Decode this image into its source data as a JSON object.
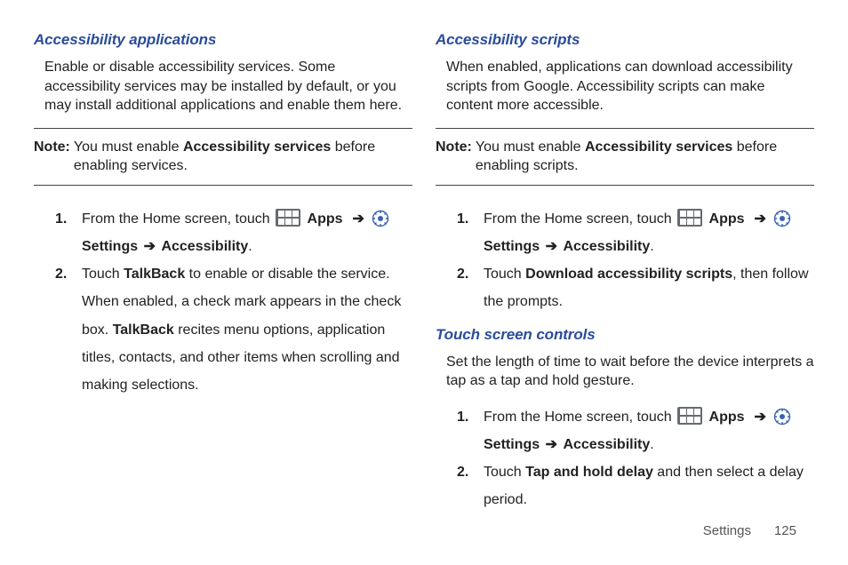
{
  "footer": {
    "section": "Settings",
    "page": "125"
  },
  "left": {
    "heading": "Accessibility applications",
    "intro": "Enable or disable accessibility services. Some accessibility services may be installed by default, or you may install additional applications and enable them here.",
    "note": {
      "label": "Note:",
      "pre": "You must enable ",
      "bold": "Accessibility services",
      "post": " before enabling services."
    },
    "steps": {
      "s1": {
        "pre": "From the Home screen, touch ",
        "apps": "Apps",
        "arrow1": "➔",
        "settings": "Settings",
        "arrow2": "➔",
        "acc": "Accessibility",
        "end": "."
      },
      "s2": {
        "pre": "Touch ",
        "tb1": "TalkBack",
        "mid": " to enable or disable the service. When enabled, a check mark appears in the check box. ",
        "tb2": "TalkBack",
        "post": " recites menu options, application titles, contacts, and other items when scrolling and making selections."
      }
    }
  },
  "right": {
    "sec1": {
      "heading": "Accessibility scripts",
      "intro": "When enabled, applications can download accessibility scripts from Google. Accessibility scripts can make content more accessible.",
      "note": {
        "label": "Note:",
        "pre": "You must enable ",
        "bold": "Accessibility services",
        "post": " before enabling scripts."
      },
      "s1": {
        "pre": "From the Home screen, touch ",
        "apps": "Apps",
        "arrow1": "➔",
        "settings": "Settings",
        "arrow2": "➔",
        "acc": "Accessibility",
        "end": "."
      },
      "s2": {
        "pre": "Touch ",
        "bold": "Download accessibility scripts",
        "post": ", then follow the prompts."
      }
    },
    "sec2": {
      "heading": "Touch screen controls",
      "intro": "Set the length of time to wait before the device interprets a tap as a tap and hold gesture.",
      "s1": {
        "pre": "From the Home screen, touch ",
        "apps": "Apps",
        "arrow1": "➔",
        "settings": "Settings",
        "arrow2": "➔",
        "acc": "Accessibility",
        "end": "."
      },
      "s2": {
        "pre": "Touch ",
        "bold": "Tap and hold delay",
        "post": " and then select a delay period."
      }
    }
  },
  "icons": {
    "apps_alt": "apps-icon",
    "settings_alt": "settings-icon",
    "arrow": "➔"
  }
}
